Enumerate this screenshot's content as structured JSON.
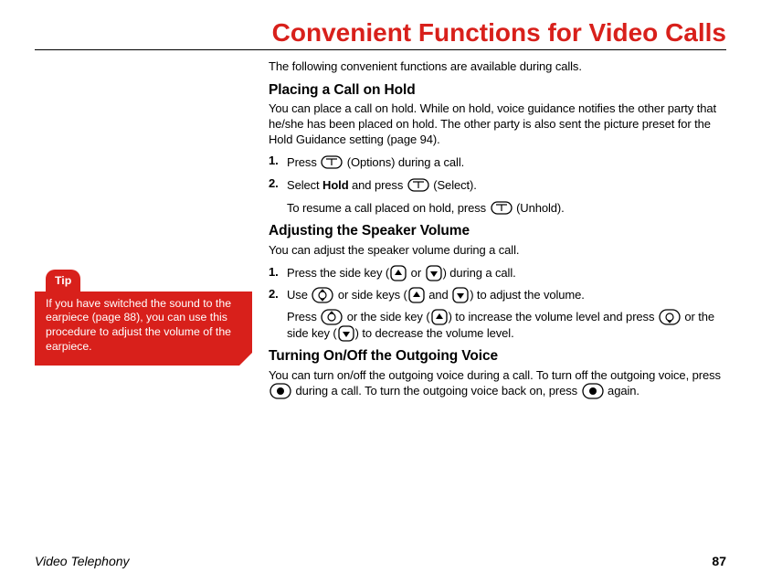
{
  "title": "Convenient Functions for Video Calls",
  "intro": "The following convenient functions are available during calls.",
  "section1": {
    "heading": "Placing a Call on Hold",
    "para": "You can place a call on hold. While on hold, voice guidance notifies the other party that he/she has been placed on hold. The other party is also sent the picture preset for the Hold Guidance setting (page 94).",
    "step1_a": "Press ",
    "step1_b": " (Options) during a call.",
    "step2_a": "Select ",
    "step2_bold": "Hold",
    "step2_b": " and press ",
    "step2_c": " (Select).",
    "resume_a": "To resume a call placed on hold, press ",
    "resume_b": " (Unhold).",
    "num1": "1.",
    "num2": "2."
  },
  "section2": {
    "heading": "Adjusting the Speaker Volume",
    "para": "You can adjust the speaker volume during a call.",
    "num1": "1.",
    "num2": "2.",
    "step1_a": "Press the side key (",
    "step1_b": " or ",
    "step1_c": ") during a call.",
    "step2_a": "Use ",
    "step2_b": " or side keys (",
    "step2_c": " and ",
    "step2_d": ") to adjust the volume.",
    "sub_a": "Press ",
    "sub_b": " or the side key (",
    "sub_c": ") to increase the volume level and press ",
    "sub_d": " or the side key (",
    "sub_e": ") to decrease the volume level."
  },
  "section3": {
    "heading": "Turning On/Off the Outgoing Voice",
    "para_a": "You can turn on/off the outgoing voice during a call. To turn off the outgoing voice, press ",
    "para_b": " during a call. To turn the outgoing voice back on, press ",
    "para_c": " again."
  },
  "tip": {
    "label": "Tip",
    "body": "If you have switched the sound to the earpiece (page 88), you can use this procedure to adjust the volume of the earpiece."
  },
  "footer": {
    "section": "Video Telephony",
    "page": "87"
  },
  "icons": {
    "softkey": "softkey-icon",
    "sideup": "side-up-icon",
    "sidedown": "side-down-icon",
    "updown": "nav-updown-icon",
    "up": "nav-up-icon",
    "down": "nav-down-icon",
    "center": "nav-center-icon"
  }
}
